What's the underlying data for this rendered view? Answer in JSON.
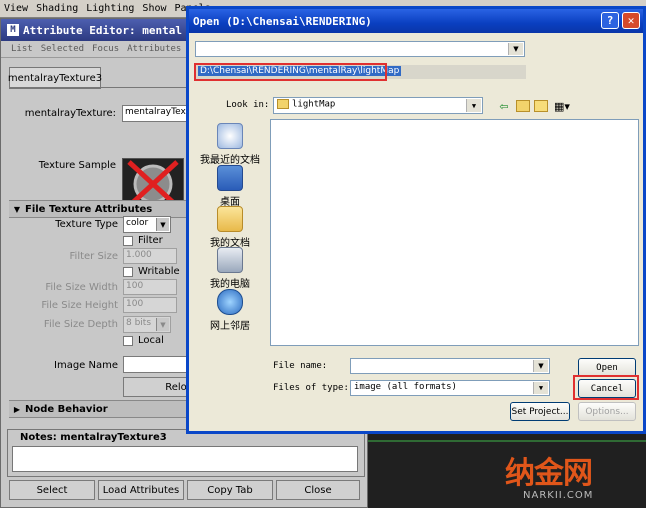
{
  "maya_menu": [
    "View",
    "Shading",
    "Lighting",
    "Show",
    "Panels"
  ],
  "attr_editor": {
    "title": "Attribute Editor: mental",
    "menu": [
      "List",
      "Selected",
      "Focus",
      "Attributes"
    ],
    "node_tab": "mentalrayTexture3",
    "texture_label": "mentalrayTexture:",
    "texture_value": "mentalrayTextur",
    "texture_sample_label": "Texture Sample",
    "section_file": "File Texture Attributes",
    "texture_type_label": "Texture Type",
    "texture_type_value": "color",
    "filter_label": "Filter",
    "filter_size_label": "Filter Size",
    "filter_size_value": "1.000",
    "writable_label": "Writable",
    "file_width_label": "File Size Width",
    "file_width_value": "100",
    "file_height_label": "File Size Height",
    "file_height_value": "100",
    "file_depth_label": "File Size Depth",
    "file_depth_value": "8 bits",
    "local_label": "Local",
    "image_name_label": "Image Name",
    "reload_label": "Relo",
    "section_node": "Node Behavior",
    "notes_label": "Notes: mentalrayTexture3",
    "buttons": [
      "Select",
      "Load Attributes",
      "Copy Tab",
      "Close"
    ]
  },
  "open_dialog": {
    "title": "Open (D:\\Chensai\\RENDERING)",
    "path": "D:\\Chensai\\RENDERING\\mentalRay\\lightMap",
    "look_in_label": "Look in:",
    "look_in_value": "lightMap",
    "places": [
      "我最近的文档",
      "桌面",
      "我的文档",
      "我的电脑",
      "网上邻居"
    ],
    "file_name_label": "File name:",
    "file_name_value": "",
    "files_of_type_label": "Files of type:",
    "files_of_type_value": "image (all formats)",
    "open_label": "Open",
    "cancel_label": "Cancel",
    "set_project_label": "Set Project...",
    "options_label": "Options..."
  },
  "watermark": {
    "text": "纳金网",
    "url": "NARKII.COM"
  }
}
